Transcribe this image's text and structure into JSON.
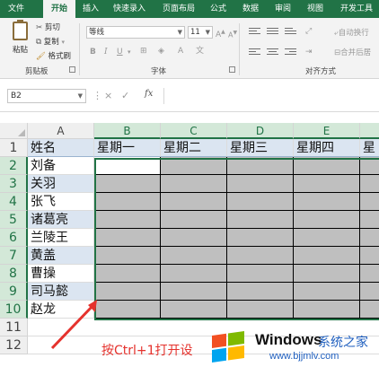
{
  "ribbon_tabs": [
    {
      "label": "文件",
      "active": false
    },
    {
      "label": "开始",
      "active": true
    },
    {
      "label": "插入",
      "active": false
    },
    {
      "label": "快速录入",
      "active": false
    },
    {
      "label": "页面布局",
      "active": false
    },
    {
      "label": "公式",
      "active": false
    },
    {
      "label": "数据",
      "active": false
    },
    {
      "label": "审阅",
      "active": false
    },
    {
      "label": "视图",
      "active": false
    },
    {
      "label": "开发工具",
      "active": false
    }
  ],
  "clipboard": {
    "paste_label": "粘贴",
    "cut_label": "剪切",
    "copy_label": "复制",
    "format_painter_label": "格式刷",
    "group_label": "剪贴板"
  },
  "font": {
    "font_name": "等线",
    "font_size": "11",
    "group_label": "字体",
    "bold": "B",
    "italic": "I",
    "underline": "U",
    "grow": "A",
    "shrink": "A"
  },
  "alignment": {
    "wrap_label": "自动换行",
    "merge_label": "合并后居",
    "group_label": "对齐方式"
  },
  "formula_bar": {
    "name_box": "B2",
    "cancel_icon": "×",
    "enter_icon": "✓",
    "fx_label": "fx",
    "formula": ""
  },
  "columns": [
    "A",
    "B",
    "C",
    "D",
    "E"
  ],
  "rows": [
    "1",
    "2",
    "3",
    "4",
    "5",
    "6",
    "7",
    "8",
    "9",
    "10",
    "11",
    "12"
  ],
  "header_row": [
    "姓名",
    "星期一",
    "星期二",
    "星期三",
    "星期四",
    "星"
  ],
  "names": [
    "刘备",
    "关羽",
    "张飞",
    "诸葛亮",
    "兰陵王",
    "黄盖",
    "曹操",
    "司马懿",
    "赵龙"
  ],
  "selected_range": "B2:F10",
  "annotation": "按Ctrl+1打开设",
  "watermark": {
    "brand": "Windows",
    "cn": "系统之家",
    "url": "www.bjjmlv.com"
  }
}
